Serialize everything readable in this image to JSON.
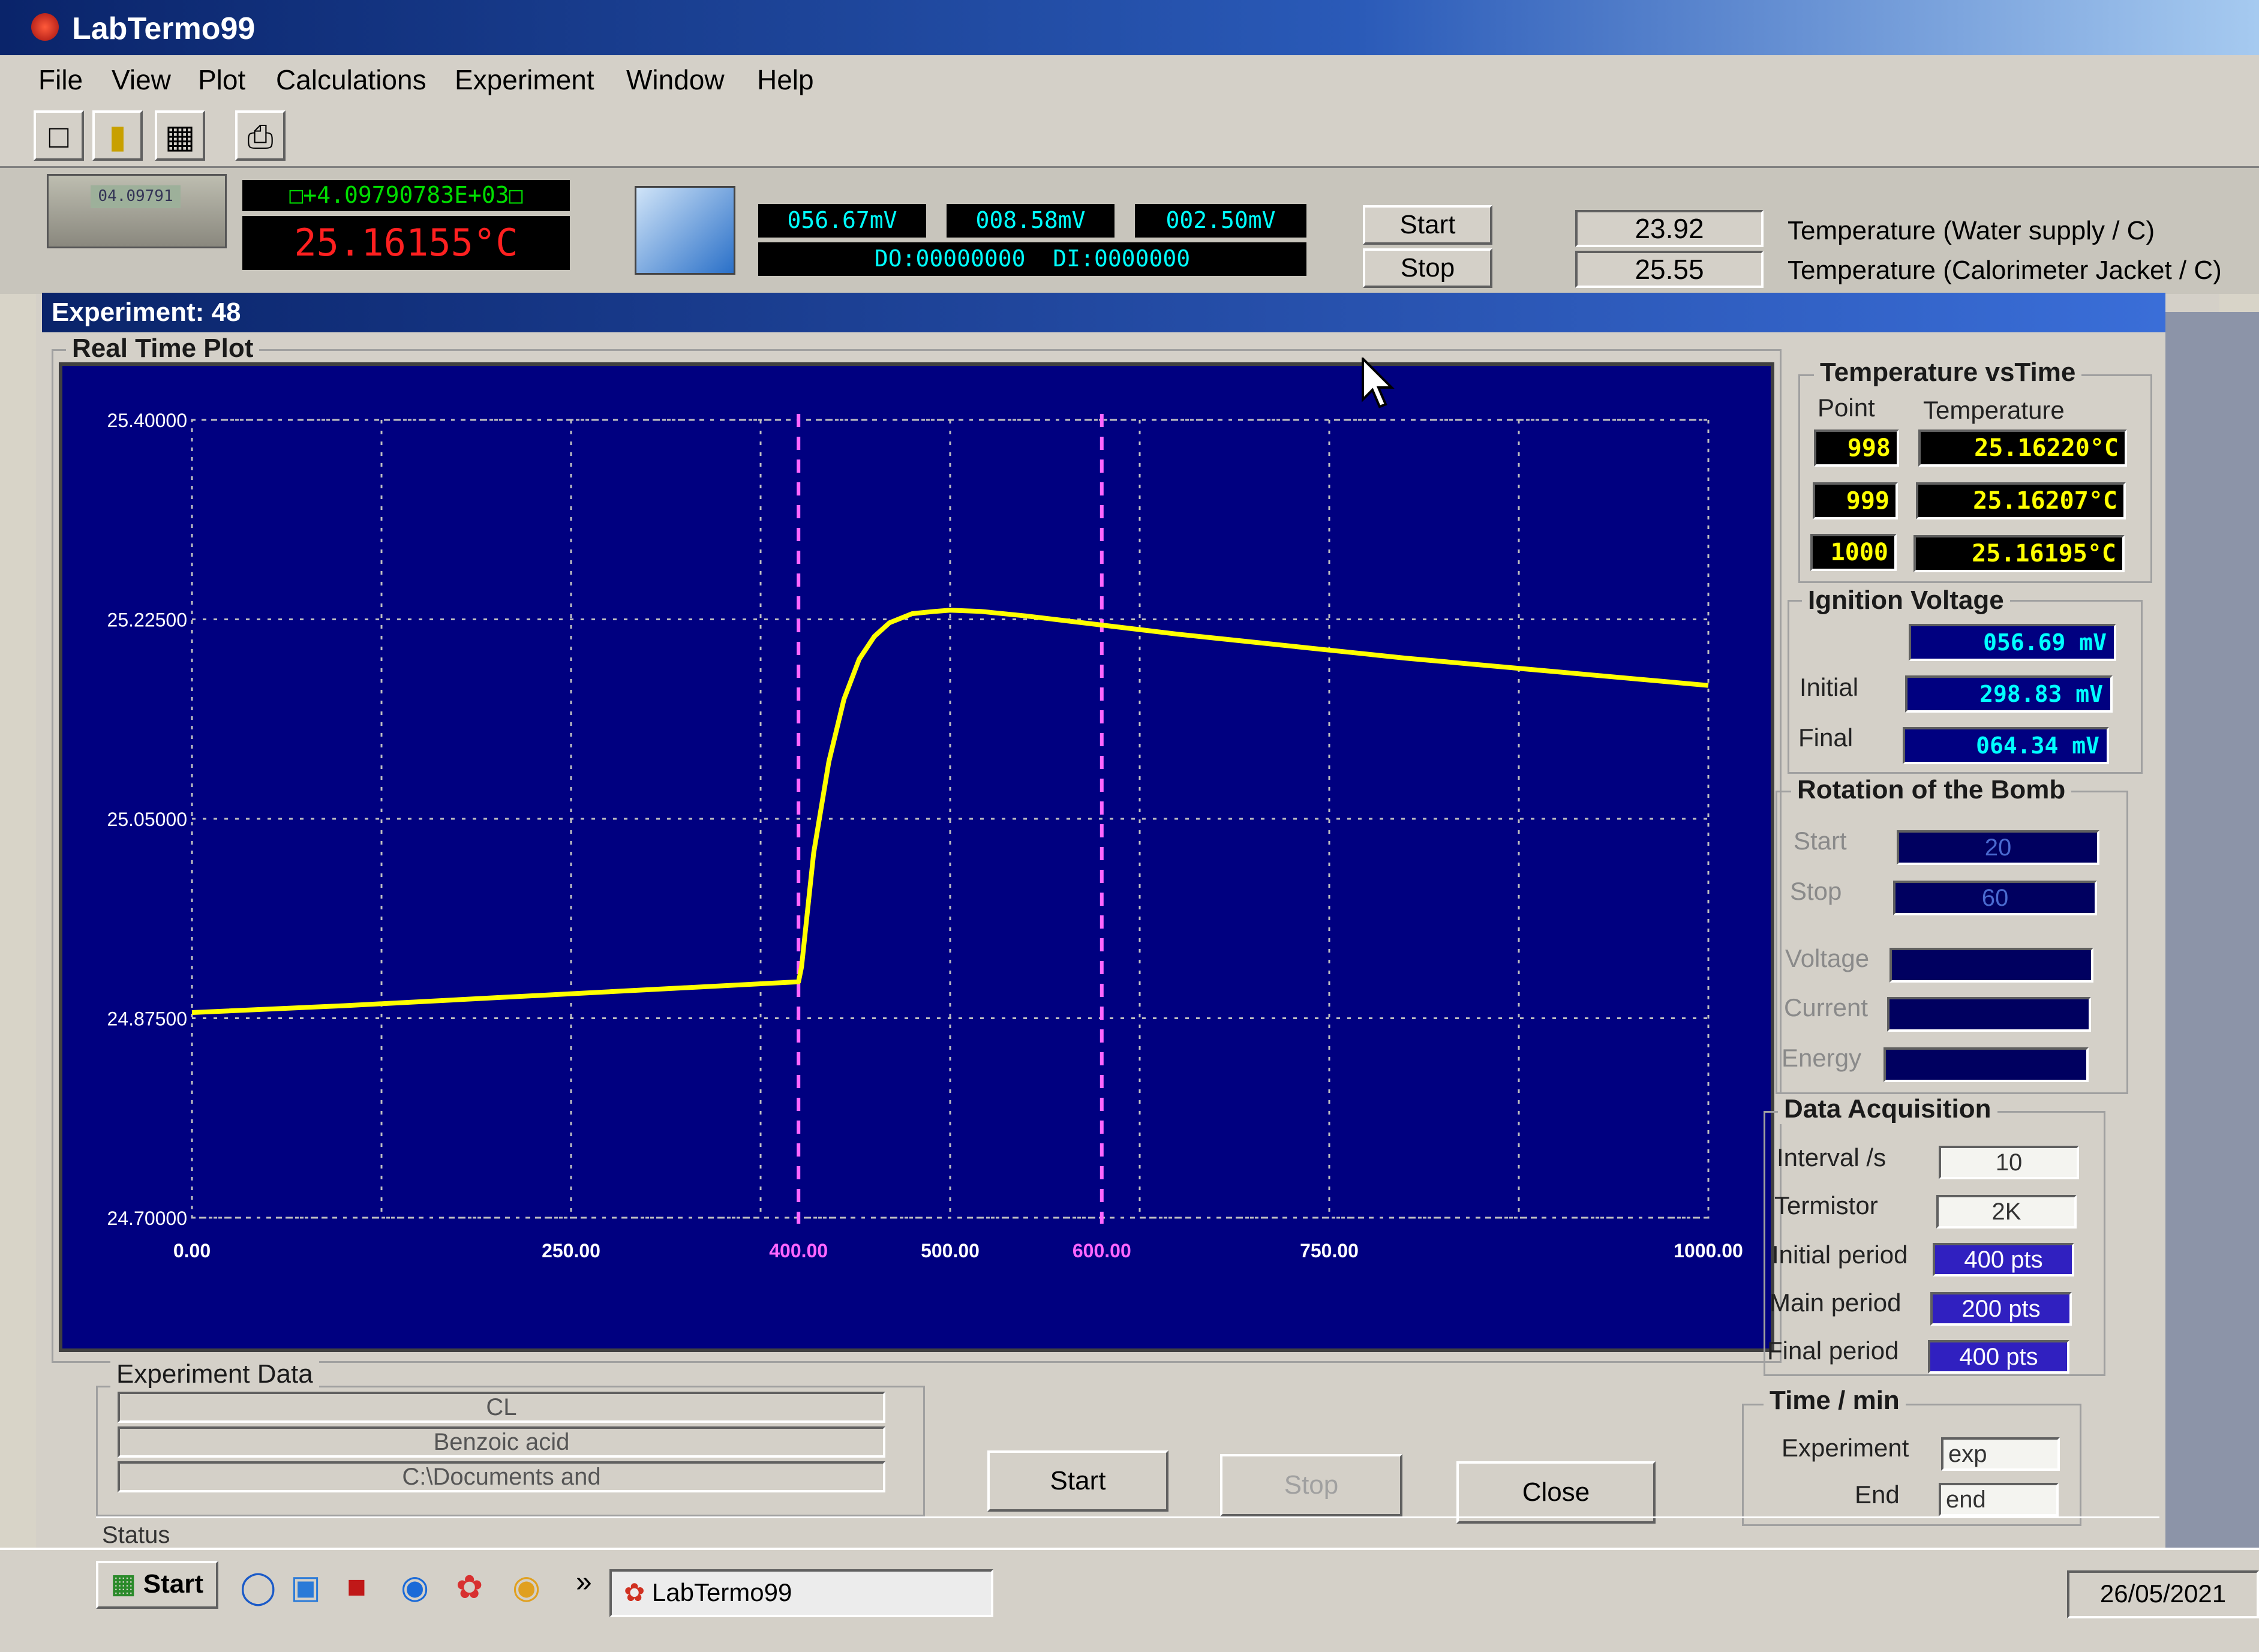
{
  "window": {
    "title": "LabTermo99"
  },
  "menu": [
    "File",
    "View",
    "Plot",
    "Calculations",
    "Experiment",
    "Window",
    "Help"
  ],
  "instrument": {
    "meter_small": "04.09791",
    "meter_reading": "□+4.09790783E+03□",
    "temperature": "25.16155°C",
    "voltages": [
      "056.67mV",
      "008.58mV",
      "002.50mV"
    ],
    "digital": "DO:00000000  DI:0000000",
    "start_label": "Start",
    "stop_label": "Stop",
    "water_temp_value": "23.92",
    "jacket_temp_value": "25.55",
    "water_temp_label": "Temperature (Water supply / C)",
    "jacket_temp_label": "Temperature (Calorimeter Jacket / C)"
  },
  "experiment": {
    "header": "Experiment: 48"
  },
  "plot": {
    "title": "Real Time Plot",
    "colors": {
      "background": "#000080",
      "series": "#ffff00",
      "markers": "#ff66ff",
      "grid": "#c0c0c0"
    }
  },
  "chart_data": {
    "type": "line",
    "xlim": [
      0,
      1000
    ],
    "ylim": [
      24.7,
      25.4
    ],
    "x_ticks": [
      "0.00",
      "250.00",
      "400.00",
      "500.00",
      "600.00",
      "750.00",
      "1000.00"
    ],
    "x_tick_values": [
      0,
      250,
      400,
      500,
      600,
      750,
      1000
    ],
    "y_ticks": [
      "24.70000",
      "24.87500",
      "25.05000",
      "25.22500",
      "25.40000"
    ],
    "y_tick_values": [
      24.7,
      24.875,
      25.05,
      25.225,
      25.4
    ],
    "vertical_markers": [
      400,
      600
    ],
    "series": [
      {
        "x": [
          0,
          100,
          200,
          300,
          400,
          402,
          410,
          420,
          430,
          440,
          450,
          460,
          475,
          490,
          500,
          520,
          550,
          600,
          650,
          700,
          750,
          800,
          850,
          900,
          950,
          1000
        ],
        "y": [
          24.88,
          24.886,
          24.893,
          24.9,
          24.907,
          24.92,
          25.02,
          25.1,
          25.155,
          25.19,
          25.21,
          25.222,
          25.23,
          25.232,
          25.233,
          25.232,
          25.228,
          25.22,
          25.212,
          25.205,
          25.198,
          25.191,
          25.185,
          25.179,
          25.173,
          25.167
        ]
      }
    ]
  },
  "temp_vs_time": {
    "title": "Temperature vsTime",
    "col_point": "Point",
    "col_temp": "Temperature",
    "rows": [
      {
        "point": "998",
        "temp": "25.16220°C"
      },
      {
        "point": "999",
        "temp": "25.16207°C"
      },
      {
        "point": "1000",
        "temp": "25.16195°C"
      }
    ]
  },
  "ignition": {
    "title": "Ignition Voltage",
    "current": "056.69 mV",
    "initial_label": "Initial",
    "initial": "298.83 mV",
    "final_label": "Final",
    "final": "064.34 mV"
  },
  "rotation": {
    "title": "Rotation of the Bomb",
    "start_label": "Start",
    "start": "20",
    "stop_label": "Stop",
    "stop": "60",
    "voltage_label": "Voltage",
    "current_label": "Current",
    "energy_label": "Energy"
  },
  "acquisition": {
    "title": "Data Acquisition",
    "interval_label": "Interval /s",
    "interval": "10",
    "termistor_label": "Termistor",
    "termistor": "2K",
    "initial_label": "Initial period",
    "initial": "400 pts",
    "main_label": "Main period",
    "main": "200 pts",
    "final_label": "Final period",
    "final": "400 pts"
  },
  "time": {
    "title": "Time / min",
    "experiment_label": "Experiment",
    "experiment": "exp",
    "end_label": "End",
    "end": "end"
  },
  "exp_data": {
    "title": "Experiment  Data",
    "fields": [
      "CL",
      "Benzoic acid",
      "C:\\Documents and"
    ]
  },
  "buttons": {
    "start": "Start",
    "stop": "Stop",
    "close": "Close"
  },
  "status": {
    "label": "Status"
  },
  "taskbar": {
    "start": "Start",
    "more": "»",
    "task": "LabTermo99",
    "date": "26/05/2021"
  }
}
